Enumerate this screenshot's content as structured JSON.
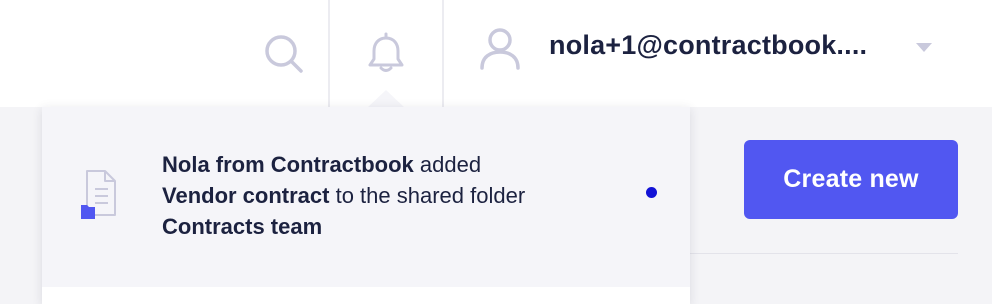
{
  "header": {
    "user_email": "nola+1@contractbook...."
  },
  "notification": {
    "actor": "Nola from Contractbook",
    "verb_added": " added",
    "document_name": "Vendor contract",
    "phrase_shared_folder": " to the shared folder",
    "folder_name": "Contracts team"
  },
  "main": {
    "create_button_label": "Create new"
  },
  "colors": {
    "accent": "#5157f1",
    "unread_dot": "#1212d6",
    "icon_muted": "#c9c9dc",
    "text_primary": "#1c2240",
    "panel_bg": "#f5f5f9"
  }
}
